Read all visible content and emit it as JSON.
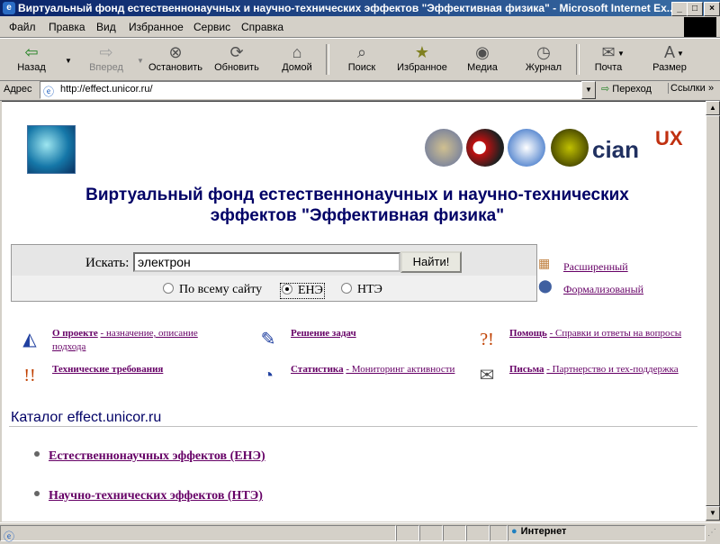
{
  "window": {
    "title": "Виртуальный фонд естественнонаучных и научно-технических эффектов \"Эффективная физика\" - Microsoft Internet Ex...",
    "buttons": [
      "_",
      "□",
      "×"
    ]
  },
  "menu": [
    "Файл",
    "Правка",
    "Вид",
    "Избранное",
    "Сервис",
    "Справка"
  ],
  "toolbar": {
    "back": "Назад",
    "forward": "Вперед",
    "stop": "Остановить",
    "refresh": "Обновить",
    "home": "Домой",
    "search": "Поиск",
    "favorites": "Избранное",
    "media": "Медиа",
    "history": "Журнал",
    "mail": "Почта",
    "size": "Размер"
  },
  "address": {
    "label": "Адрес",
    "url": "http://effect.unicor.ru/",
    "go": "Переход",
    "links": "Ссылки"
  },
  "page": {
    "heading_line1": "Виртуальный фонд естественнонаучных и научно-технических",
    "heading_line2": "эффектов \"Эффективная физика\"",
    "search": {
      "label": "Искать:",
      "value": "электрон",
      "button": "Найти!",
      "options": [
        "По всему сайту",
        "ЕНЭ",
        "НТЭ"
      ],
      "selected": "ЕНЭ"
    },
    "advanced": [
      "Расширенный",
      "Формализованый"
    ],
    "features": [
      {
        "title": "О проекте",
        "desc": "- назначение, описание подхода"
      },
      {
        "title": "Решение задач",
        "desc": ""
      },
      {
        "title": "Помощь",
        "desc": "- Справки и ответы на вопросы"
      },
      {
        "title": "Технические требования",
        "desc": ""
      },
      {
        "title": "Статистика",
        "desc": "- Мониторинг активности"
      },
      {
        "title": "Письма",
        "desc": "- Партнерство и тех-поддержка"
      }
    ],
    "catalog_title": "Каталог effect.unicor.ru",
    "catalog_items": [
      "Естественнонаучных эффектов (ЕНЭ)",
      "Научно-технических эффектов (НТЭ)"
    ]
  },
  "status": {
    "zone": "Интернет"
  },
  "colors": {
    "heading": "#000066",
    "link": "#660066",
    "titlebar": "#0a246a"
  }
}
